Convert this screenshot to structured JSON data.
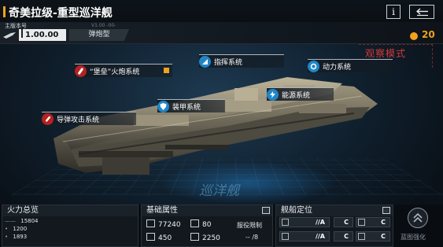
{
  "header": {
    "title": "奇美拉级-重型巡洋舰",
    "info_label": "i"
  },
  "version": {
    "label": "主版本号",
    "value": "1.00.00",
    "code": "V1.00 -00-",
    "type": "弹炮型"
  },
  "currency": {
    "count": "20",
    "color": "#f0a21c"
  },
  "mode_label": "观察模式",
  "systems": {
    "weapon": "“堡垒”火炮系统",
    "command": "指挥系统",
    "power": "动力系统",
    "armor": "装甲系统",
    "energy": "能源系统",
    "missile": "导弹攻击系统"
  },
  "hologram_text": "巡洋舰",
  "firepower": {
    "title": "火力总览",
    "rows": [
      {
        "label": "——",
        "value": "15804"
      },
      {
        "label": "•",
        "value": "1200"
      },
      {
        "label": "•",
        "value": "1893"
      }
    ]
  },
  "attributes": {
    "title": "基础属性",
    "hp": "77240",
    "armor": "80",
    "speed": "450",
    "cost": "2250",
    "limit_label": "服役限制",
    "limit_value": "-- /8"
  },
  "positioning": {
    "title": "舰船定位",
    "cells": [
      {
        "text": "//A"
      },
      {
        "text": "C"
      },
      {
        "text": "C"
      },
      {
        "text": "//A"
      },
      {
        "text": "C"
      },
      {
        "text": "C"
      }
    ]
  },
  "upgrade": {
    "label": "蓝图强化"
  },
  "colors": {
    "accent": "#f0a21c",
    "observe_red": "#d33a3a",
    "icon_red": "#b52222",
    "icon_blue": "#1f86c8"
  }
}
